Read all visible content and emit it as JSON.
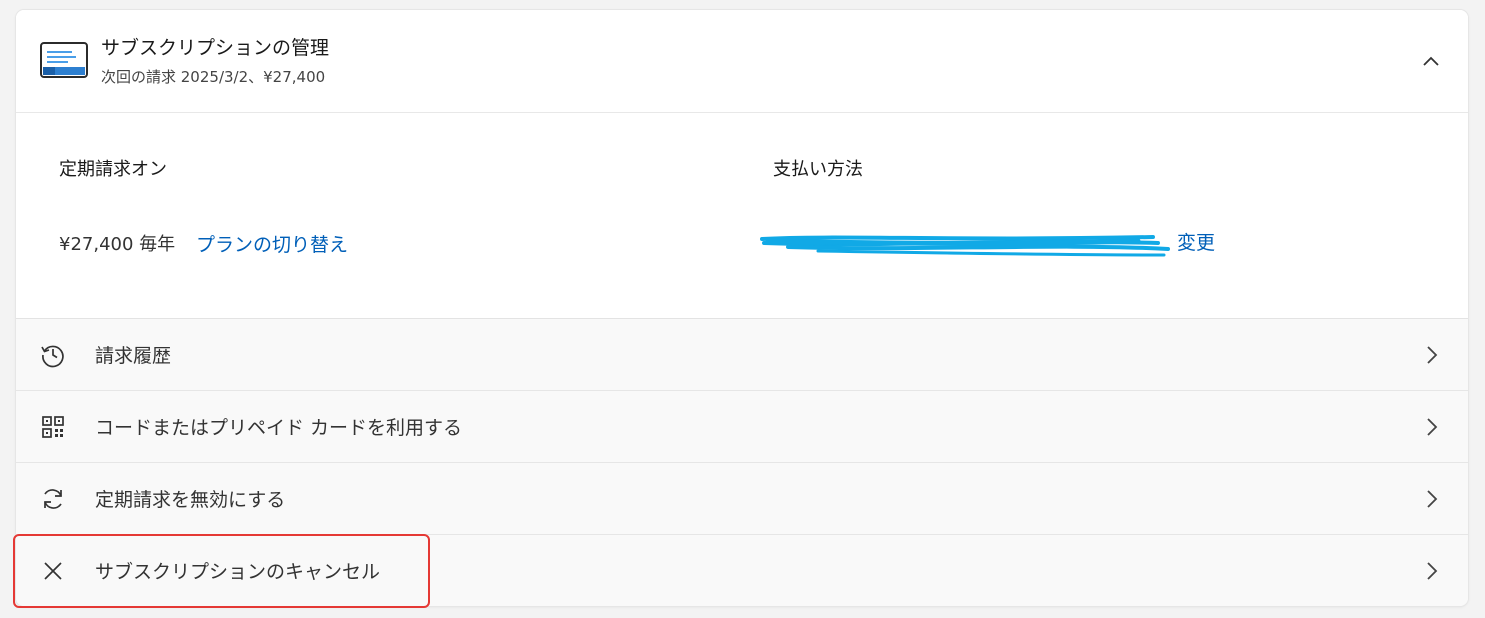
{
  "header": {
    "title": "サブスクリプションの管理",
    "subtitle": "次回の請求 2025/3/2、¥27,400",
    "icon": "subscription-card-icon",
    "collapse_icon": "chevron-up-icon"
  },
  "details": {
    "billing_label": "定期請求オン",
    "price": "¥27,400 毎年",
    "switch_plan_link": "プランの切り替え",
    "payment_label": "支払い方法",
    "change_link": "変更"
  },
  "rows": [
    {
      "label": "請求履歴",
      "icon": "history-icon"
    },
    {
      "label": "コードまたはプリペイド カードを利用する",
      "icon": "qr-code-icon"
    },
    {
      "label": "定期請求を無効にする",
      "icon": "refresh-icon"
    },
    {
      "label": "サブスクリプションのキャンセル",
      "icon": "close-icon"
    }
  ],
  "colors": {
    "link": "#005fb8",
    "redaction": "#11a9e6",
    "highlight": "#e53935"
  }
}
